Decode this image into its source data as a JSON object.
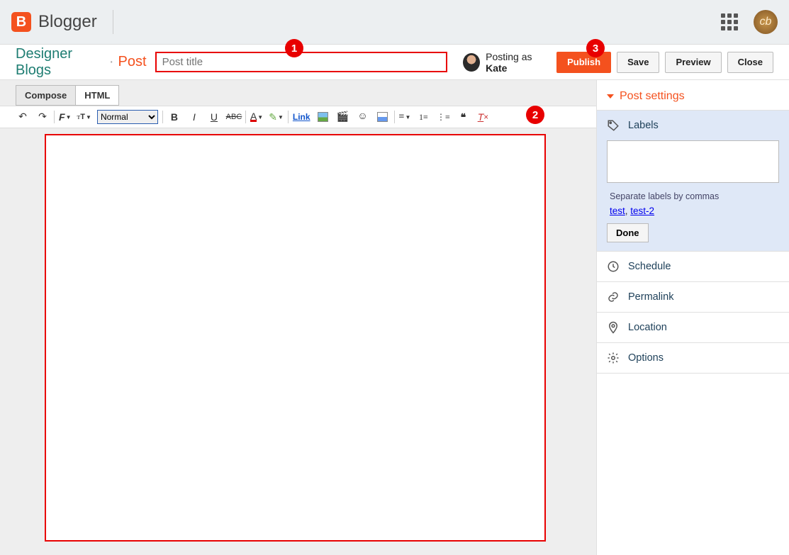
{
  "brand": {
    "logo_letter": "B",
    "name": "Blogger"
  },
  "breadcrumb": {
    "blog_name": "Designer Blogs",
    "section": "Post"
  },
  "title_input": {
    "placeholder": "Post title",
    "value": ""
  },
  "posting_as": {
    "prefix": "Posting as ",
    "user": "Kate"
  },
  "buttons": {
    "publish": "Publish",
    "save": "Save",
    "preview": "Preview",
    "close": "Close"
  },
  "tabs": {
    "compose": "Compose",
    "html": "HTML"
  },
  "toolbar": {
    "format_select": "Normal",
    "link_label": "Link"
  },
  "sidebar": {
    "header": "Post settings",
    "labels": {
      "title": "Labels",
      "hint": "Separate labels by commas",
      "suggest_a": "test",
      "suggest_b": "test-2",
      "done": "Done"
    },
    "schedule": "Schedule",
    "permalink": "Permalink",
    "location": "Location",
    "options": "Options"
  },
  "annotations": {
    "one": "1",
    "two": "2",
    "three": "3"
  }
}
